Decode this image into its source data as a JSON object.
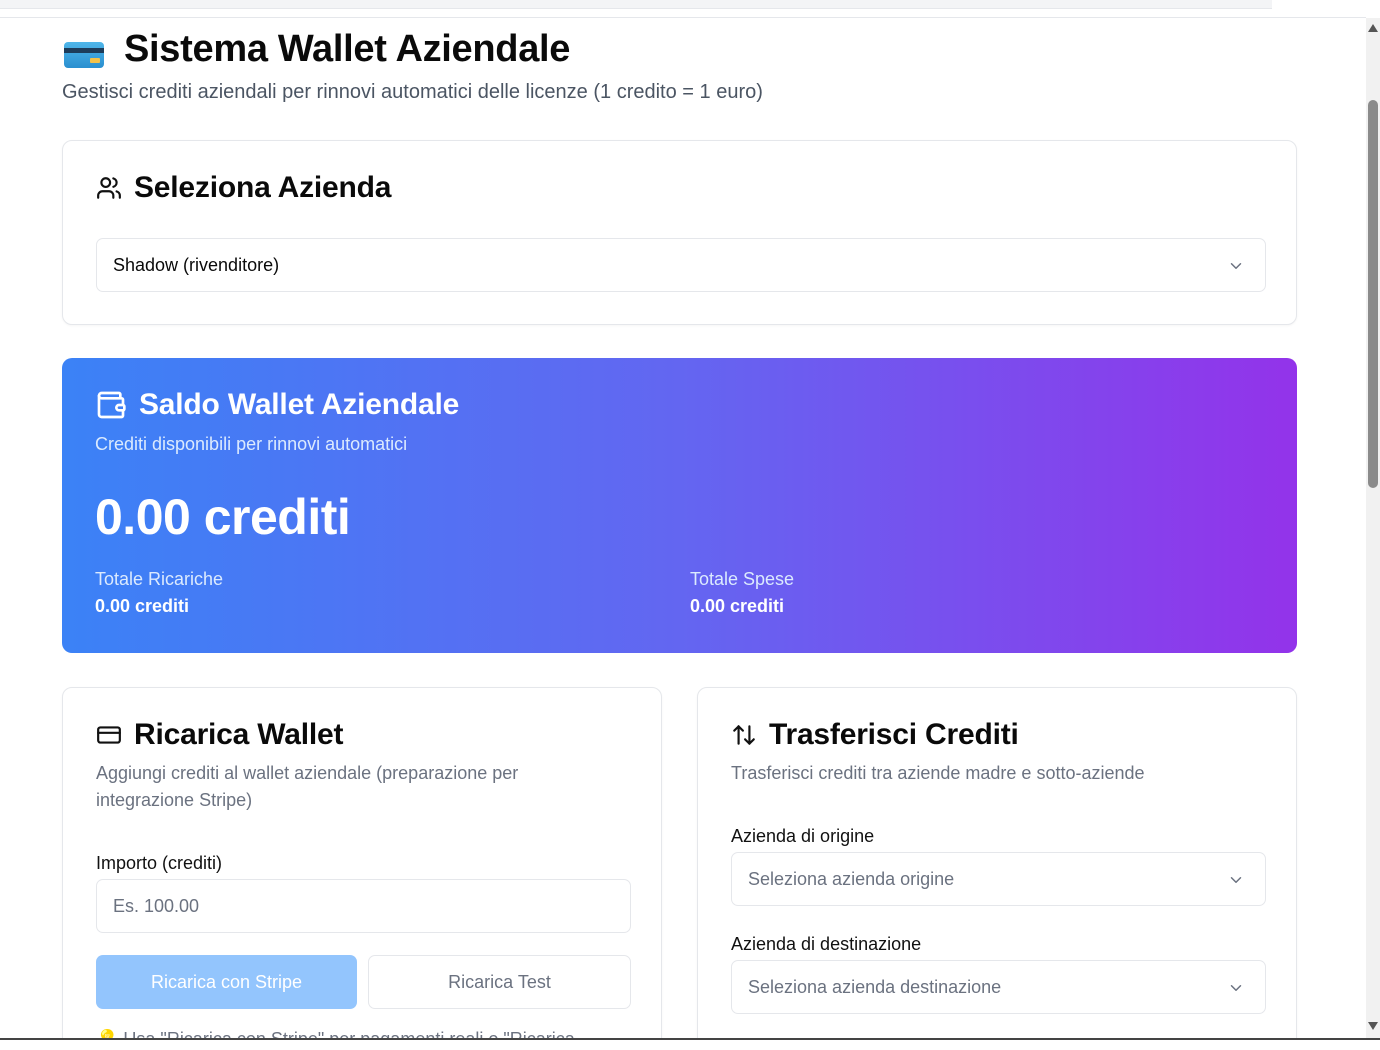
{
  "page": {
    "title": "Sistema Wallet Aziendale",
    "subtitle": "Gestisci crediti aziendali per rinnovi automatici delle licenze (1 credito = 1 euro)",
    "title_icon": "credit-card-emoji"
  },
  "company_select": {
    "title": "Seleziona Azienda",
    "icon": "users-icon",
    "selected_value": "Shadow (rivenditore)"
  },
  "balance": {
    "title": "Saldo Wallet Aziendale",
    "icon": "wallet-icon",
    "subtitle": "Crediti disponibili per rinnovi automatici",
    "amount": "0.00 crediti",
    "total_recharges_label": "Totale Ricariche",
    "total_recharges_value": "0.00 crediti",
    "total_spent_label": "Totale Spese",
    "total_spent_value": "0.00 crediti",
    "gradient": [
      "#3b82f6",
      "#6366f1",
      "#9333ea"
    ]
  },
  "recharge": {
    "title": "Ricarica Wallet",
    "icon": "credit-card-icon",
    "description": "Aggiungi crediti al wallet aziendale (preparazione per integrazione Stripe)",
    "amount_label": "Importo (crediti)",
    "amount_placeholder": "Es. 100.00",
    "stripe_button": "Ricarica con Stripe",
    "test_button": "Ricarica Test",
    "note_partial": "💡 Usa \"Ricarica con Stripe\" per pagamenti reali o \"Ricarica"
  },
  "transfer": {
    "title": "Trasferisci Crediti",
    "icon": "arrow-up-down-icon",
    "description": "Trasferisci crediti tra aziende madre e sotto-aziende",
    "origin_label": "Azienda di origine",
    "origin_placeholder": "Seleziona azienda origine",
    "destination_label": "Azienda di destinazione",
    "destination_placeholder": "Seleziona azienda destinazione"
  }
}
